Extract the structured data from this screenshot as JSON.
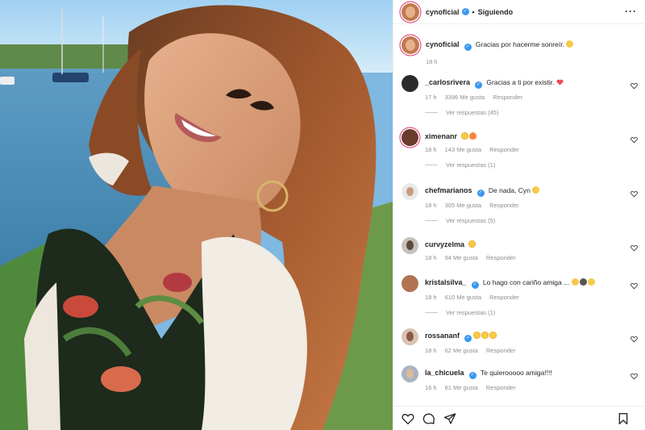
{
  "post": {
    "author": "cynoficial",
    "follow_status": "Siguiendo",
    "caption": "Gracias por hacerme sonreír.",
    "caption_time": "18 h"
  },
  "comments": [
    {
      "user": "_carlosrivera",
      "verified": true,
      "text": "Gracias a ti por existir.",
      "emojis": [
        "red-heart"
      ],
      "time": "17 h",
      "likes": "3396 Me gusta",
      "reply": "Responder",
      "view_replies": "Ver respuestas (45)"
    },
    {
      "user": "ximenanr",
      "verified": false,
      "text": "",
      "emojis": [
        "heart-eyes",
        "fire"
      ],
      "time": "18 h",
      "likes": "143 Me gusta",
      "reply": "Responder",
      "view_replies": "Ver respuestas (1)"
    },
    {
      "user": "chefmarianos",
      "verified": true,
      "text": "De nada, Cyn",
      "emojis": [
        "tongue-face"
      ],
      "time": "18 h",
      "likes": "305 Me gusta",
      "reply": "Responder",
      "view_replies": "Ver respuestas (5)"
    },
    {
      "user": "curvyzelma",
      "verified": false,
      "text": "",
      "emojis": [
        "heart-eyes"
      ],
      "time": "18 h",
      "likes": "94 Me gusta",
      "reply": "Responder",
      "view_replies": ""
    },
    {
      "user": "kristalsilva_",
      "verified": true,
      "text": "Lo hago con cariño amiga ...",
      "emojis": [
        "smile",
        "dark-glasses",
        "laugh"
      ],
      "time": "18 h",
      "likes": "610 Me gusta",
      "reply": "Responder",
      "view_replies": "Ver respuestas (1)"
    },
    {
      "user": "rossananf",
      "verified": true,
      "text": "",
      "emojis": [
        "heart-eyes",
        "heart-eyes",
        "heart-eyes"
      ],
      "time": "18 h",
      "likes": "62 Me gusta",
      "reply": "Responder",
      "view_replies": ""
    },
    {
      "user": "la_chicuela",
      "verified": true,
      "text": "Te quierooooo amiga!!!!",
      "emojis": [],
      "time": "16 h",
      "likes": "61 Me gusta",
      "reply": "Responder",
      "view_replies": ""
    }
  ],
  "colors": {
    "verified": "#3897f0",
    "heart": "#ed4956",
    "muted": "#8e8e8e",
    "text": "#262626"
  },
  "icons": {
    "more": "more-options-icon",
    "like": "heart-outline-icon",
    "comment": "comment-icon",
    "share": "send-icon",
    "save": "bookmark-icon"
  }
}
